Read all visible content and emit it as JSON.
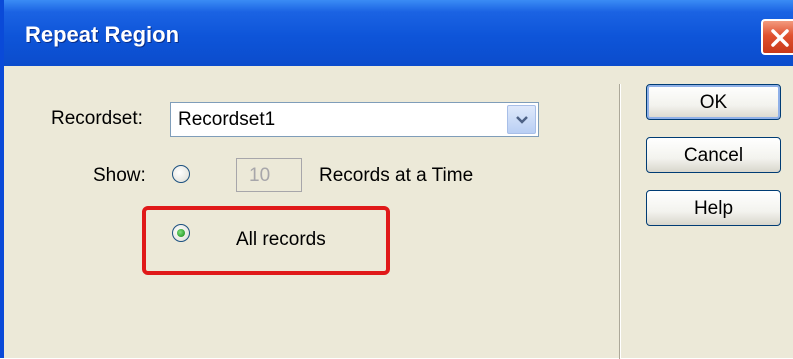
{
  "dialog": {
    "title": "Repeat Region"
  },
  "form": {
    "recordset_label": "Recordset:",
    "recordset_value": "Recordset1",
    "show_label": "Show:",
    "records_count": "10",
    "records_at_time_label": "Records at a Time",
    "all_records_label": "All records",
    "selected_option": "All records"
  },
  "buttons": {
    "ok": "OK",
    "cancel": "Cancel",
    "help": "Help"
  },
  "colors": {
    "title_bar": "#0b4ccc",
    "highlight_box": "#e01919",
    "dialog_bg": "#ece9d8"
  }
}
